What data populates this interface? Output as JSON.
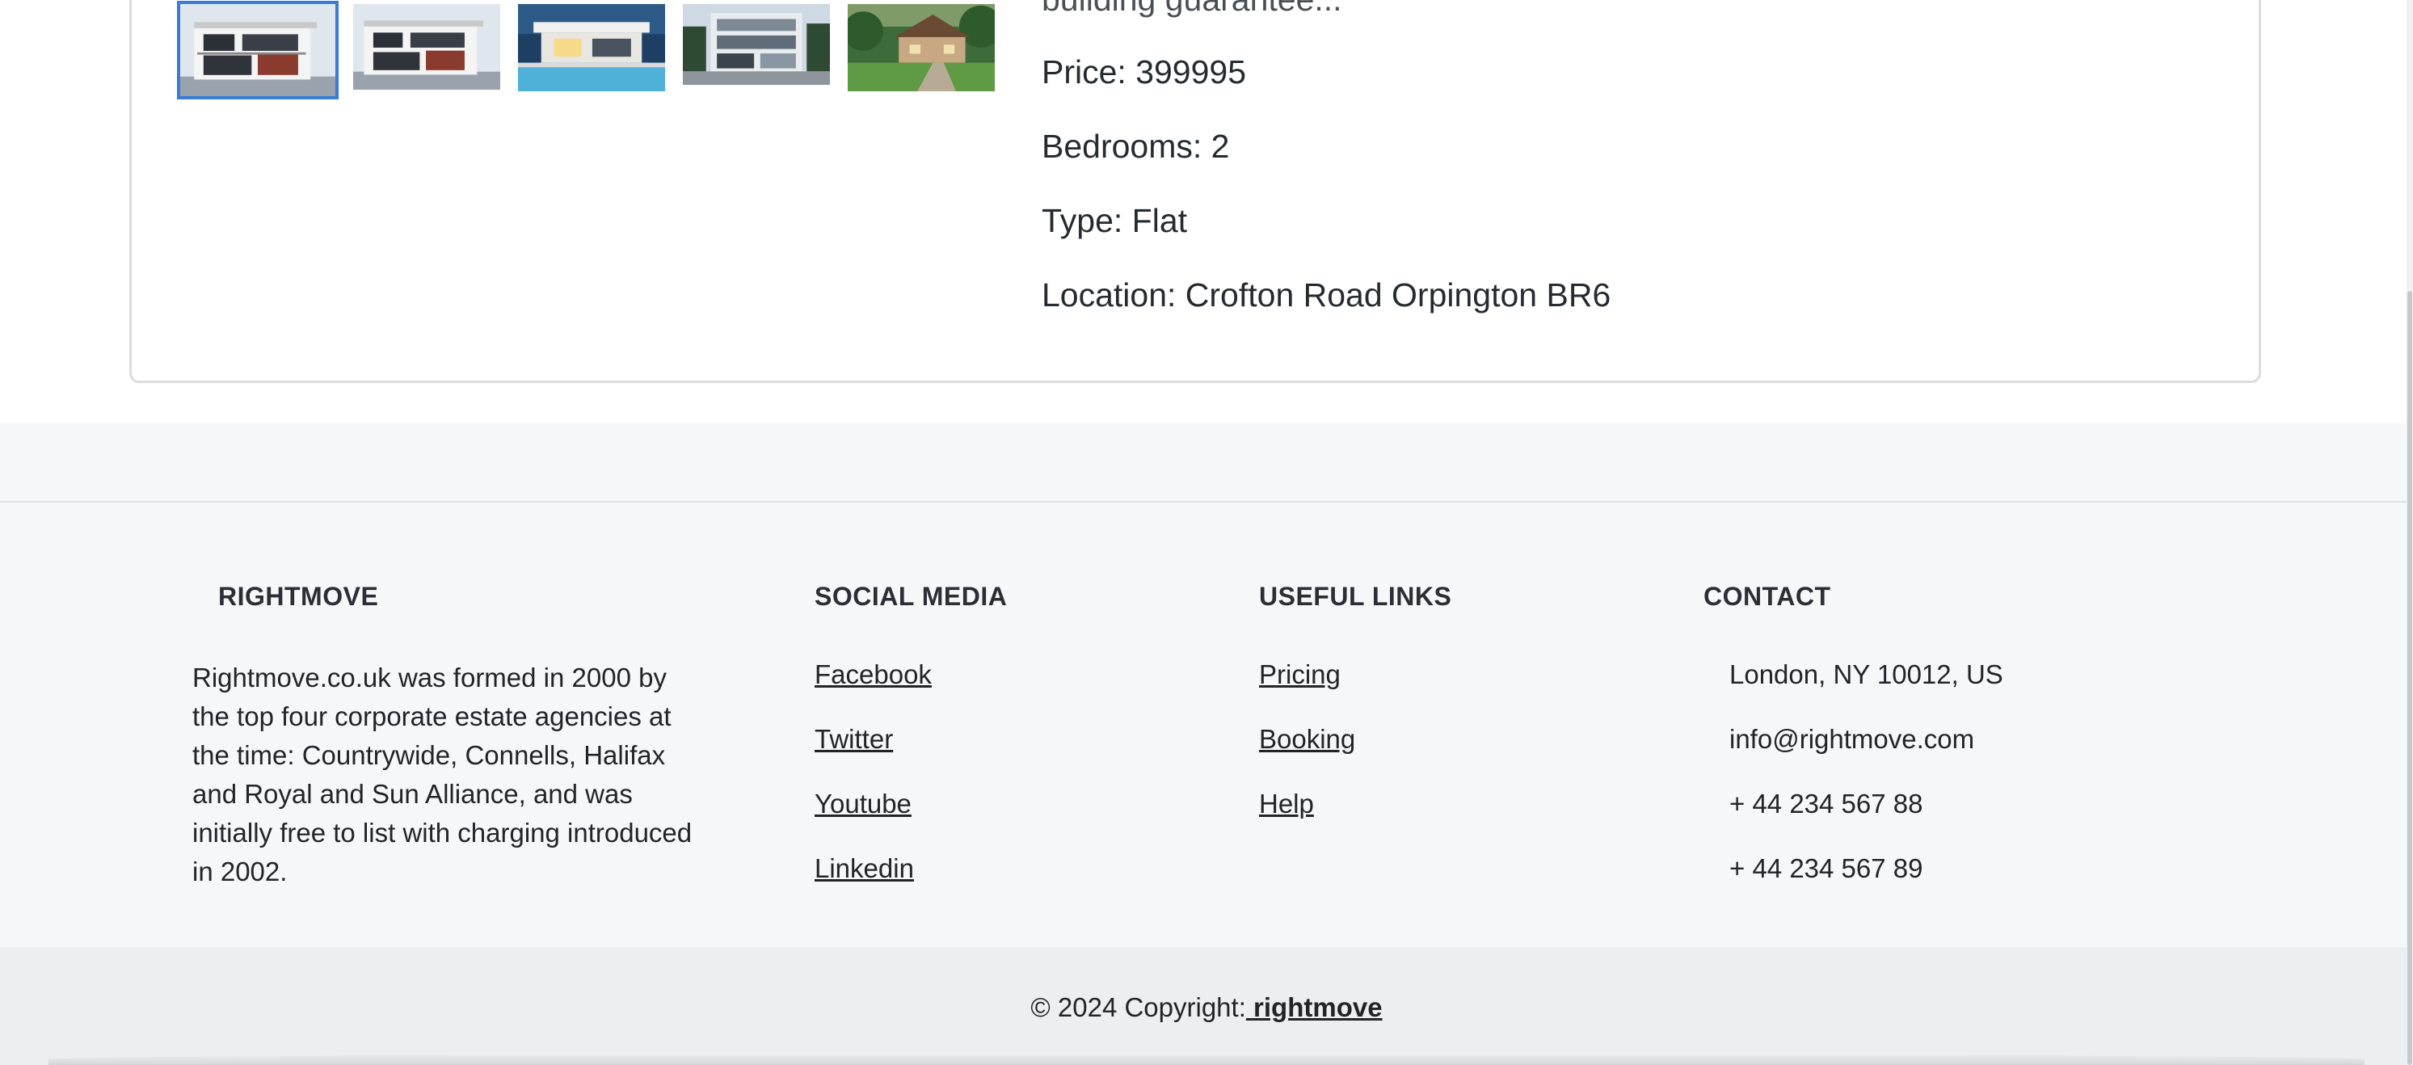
{
  "property": {
    "description_partial": "building guarantee...",
    "price": "Price: 399995",
    "bedrooms": "Bedrooms: 2",
    "type": "Type: Flat",
    "location": "Location: Crofton Road Orpington BR6",
    "thumbnails": [
      {
        "name": "modern-house-white-1",
        "selected": true
      },
      {
        "name": "modern-house-white-2",
        "selected": false
      },
      {
        "name": "modern-house-pool",
        "selected": false
      },
      {
        "name": "modern-glass-house",
        "selected": false
      },
      {
        "name": "country-house-lawn",
        "selected": false
      }
    ]
  },
  "footer": {
    "about": {
      "title": "RIGHTMOVE",
      "text": "Rightmove.co.uk was formed in 2000 by the top four corporate estate agencies at the time: Countrywide, Connells, Halifax and Royal and Sun Alliance, and was initially free to list with charging introduced in 2002."
    },
    "social": {
      "title": "SOCIAL MEDIA",
      "links": [
        "Facebook",
        "Twitter",
        "Youtube",
        "Linkedin"
      ]
    },
    "useful": {
      "title": "USEFUL LINKS",
      "links": [
        "Pricing",
        "Booking",
        "Help"
      ]
    },
    "contact": {
      "title": "CONTACT",
      "address": "London, NY 10012, US",
      "email": "info@rightmove.com",
      "phone1": "+ 44 234 567 88",
      "phone2": "+ 44 234 567 89"
    }
  },
  "copyright": {
    "text": "© 2024 Copyright:",
    "link": " rightmove"
  },
  "colors": {
    "accent_border": "#3a7bd5",
    "footer_bg": "#f6f7f9",
    "copyright_bg": "#eceef1",
    "text": "#212529"
  }
}
